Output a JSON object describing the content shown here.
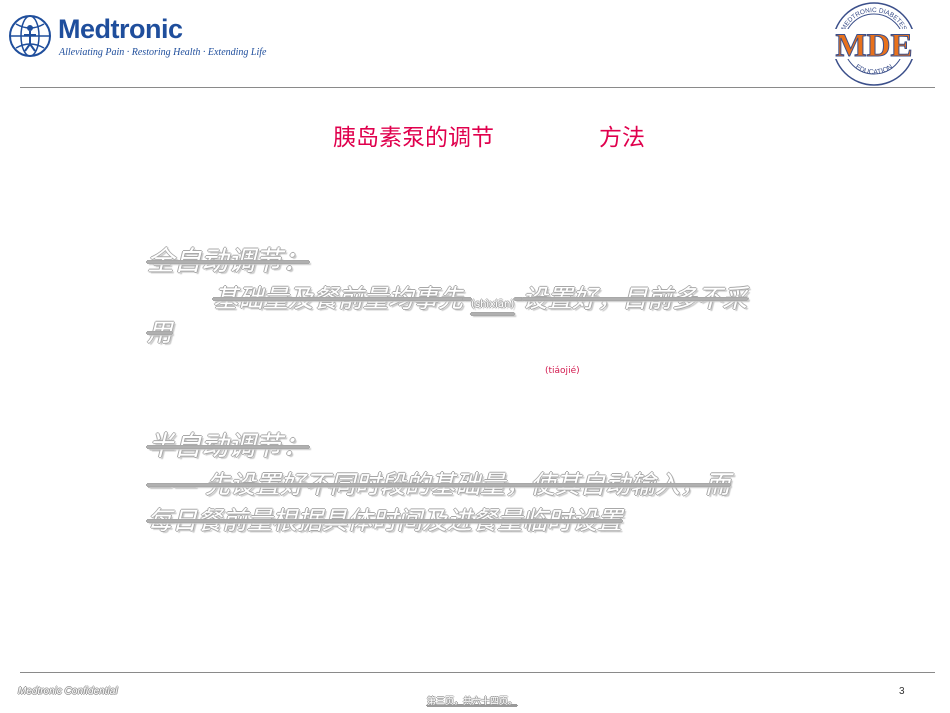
{
  "header": {
    "logo_text": "Medtronic",
    "tagline": "Alleviating Pain · Restoring Health · Extending Life",
    "badge": {
      "main": "MDE",
      "ring_top": "MEDTRONIC DIABETES",
      "ring_bottom": "EDUCATION"
    }
  },
  "title": {
    "part1": "胰岛素泵的调节",
    "part2": "方法"
  },
  "content": {
    "full_auto_heading": "全自动调节：",
    "full_auto_line1_pre": "基础量及餐前量均事先",
    "full_auto_inline": "(shìxiān)",
    "full_auto_line1_post": "设置好，目前多不采",
    "full_auto_line2": "用",
    "pinyin": "(tiáojié)",
    "semi_auto_heading": "半自动调节：",
    "semi_auto_line1": "—— 先设置好不同时段的基础量，使其自动输入，而",
    "semi_auto_line2": "每日餐前量根据具体时间及进餐量临时设置"
  },
  "footer": {
    "confidential": "Medtronic Confidential",
    "page_number": "3",
    "center": "第三页，共六十四页。"
  },
  "colors": {
    "brand_blue": "#1f4e9c",
    "title_pink": "#e0004d",
    "badge_orange": "#e8711c"
  }
}
